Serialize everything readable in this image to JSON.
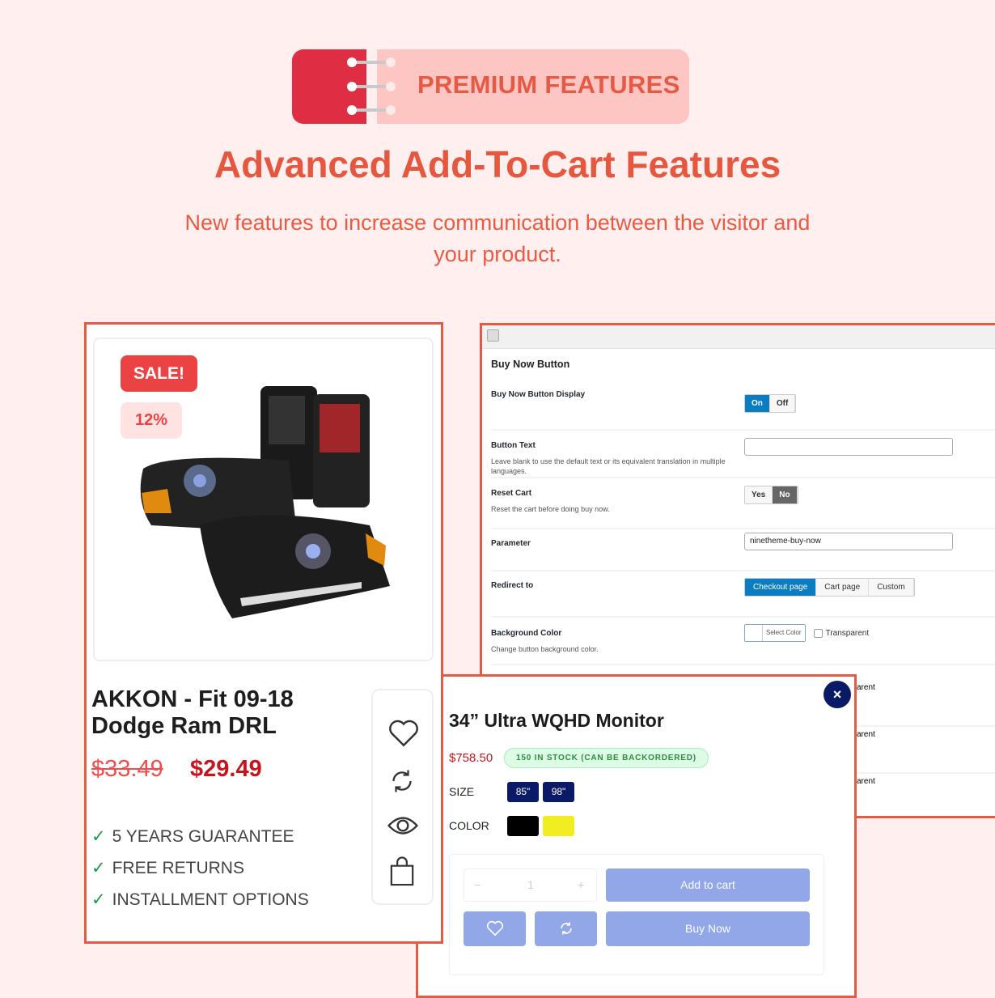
{
  "header": {
    "badge": "PREMIUM FEATURES",
    "title": "Advanced Add-To-Cart Features",
    "subtitle": "New features to increase communication between the visitor and your product."
  },
  "admin": {
    "section_title": "Buy Now Button",
    "display": {
      "label": "Buy Now Button Display",
      "on": "On",
      "off": "Off",
      "selected": "On"
    },
    "button_text": {
      "label": "Button Text",
      "desc": "Leave blank to use the default text or its equivalent translation in multiple languages.",
      "value": ""
    },
    "reset_cart": {
      "label": "Reset Cart",
      "desc": "Reset the cart before doing buy now.",
      "yes": "Yes",
      "no": "No",
      "selected": "No"
    },
    "parameter": {
      "label": "Parameter",
      "value": "ninetheme-buy-now"
    },
    "redirect": {
      "label": "Redirect to",
      "options": [
        "Checkout page",
        "Cart page",
        "Custom"
      ],
      "selected": "Checkout page"
    },
    "bg_color": {
      "label": "Background Color",
      "desc": "Change button background color.",
      "select": "Select Color",
      "transparent": "Transparent"
    },
    "hidden_rows": [
      "arent",
      "arent",
      "arent"
    ]
  },
  "popup": {
    "title": "34” Ultra WQHD Monitor",
    "price": "$758.50",
    "stock": "150 IN STOCK (CAN BE BACKORDERED)",
    "size_label": "SIZE",
    "sizes": [
      "85\"",
      "98\""
    ],
    "color_label": "COLOR",
    "colors": [
      "#000000",
      "#f0ee22"
    ],
    "qty": "1",
    "qty_minus": "−",
    "qty_plus": "+",
    "add_to_cart": "Add to cart",
    "buy_now": "Buy Now",
    "close": "×"
  },
  "product": {
    "sale": "SALE!",
    "discount": "12%",
    "name": "AKKON - Fit 09-18 Dodge Ram DRL",
    "old_price": "$33.49",
    "price": "$29.49",
    "check": "✓",
    "features": [
      "5 YEARS GUARANTEE",
      "FREE RETURNS",
      "INSTALLMENT OPTIONS"
    ]
  },
  "colors": {
    "accent": "#e45b45",
    "button": "#91a7e8",
    "navy": "#0b1a66",
    "wp_blue": "#0a7cc2"
  }
}
